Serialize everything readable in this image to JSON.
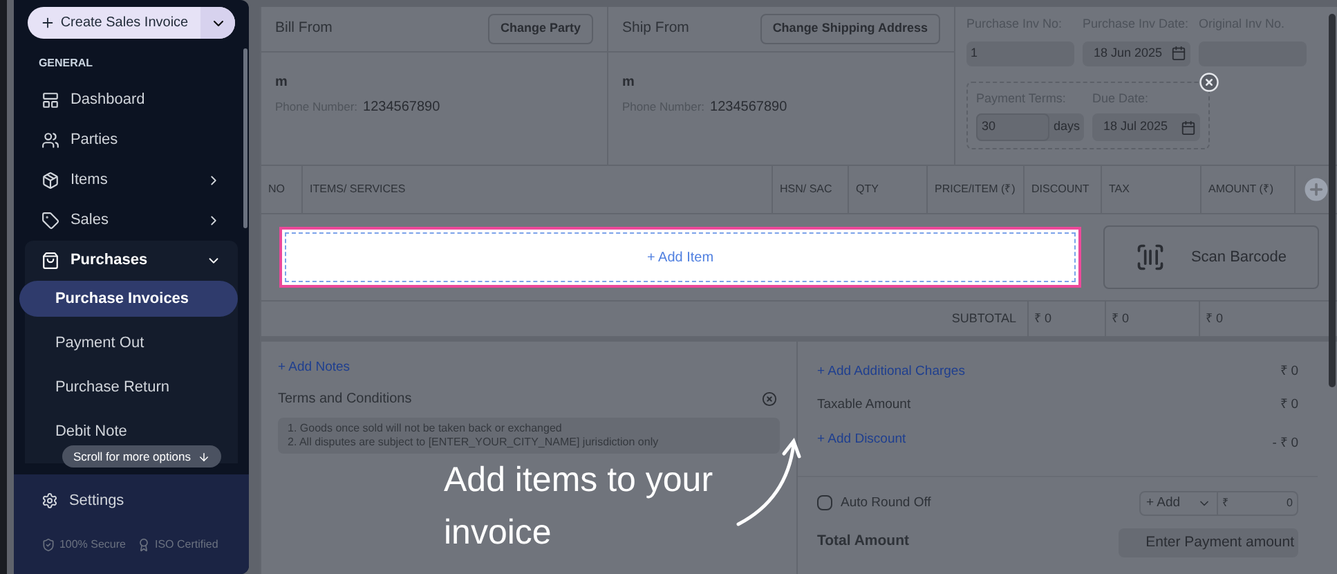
{
  "sidebar": {
    "create_button": {
      "label": "Create Sales Invoice"
    },
    "section": "GENERAL",
    "items": [
      {
        "label": "Dashboard",
        "expandable": false,
        "expanded": false
      },
      {
        "label": "Parties",
        "expandable": false,
        "expanded": false
      },
      {
        "label": "Items",
        "expandable": true,
        "expanded": false
      },
      {
        "label": "Sales",
        "expandable": true,
        "expanded": false
      },
      {
        "label": "Purchases",
        "expandable": true,
        "expanded": true,
        "children": [
          {
            "label": "Purchase Invoices",
            "selected": true
          },
          {
            "label": "Payment Out",
            "selected": false
          },
          {
            "label": "Purchase Return",
            "selected": false
          },
          {
            "label": "Debit Note",
            "selected": false
          }
        ]
      }
    ],
    "scroll_hint": "Scroll for more options",
    "settings": "Settings",
    "badges": [
      "100% Secure",
      "ISO Certified"
    ]
  },
  "bill_from": {
    "title": "Bill From",
    "button": "Change Party",
    "name": "m",
    "phone_label": "Phone Number:",
    "phone": "1234567890"
  },
  "ship_from": {
    "title": "Ship From",
    "button": "Change Shipping Address",
    "name": "m",
    "phone_label": "Phone Number:",
    "phone": "1234567890"
  },
  "invoice_info": {
    "inv_no_label": "Purchase Inv No:",
    "inv_no": "1",
    "inv_date_label": "Purchase Inv Date:",
    "inv_date": "18 Jun 2025",
    "original_label": "Original Inv No.",
    "terms_label": "Payment Terms:",
    "terms": "30",
    "terms_unit": "days",
    "due_label": "Due Date:",
    "due_date": "18 Jul 2025"
  },
  "table": {
    "columns": [
      "NO",
      "ITEMS/ SERVICES",
      "HSN/ SAC",
      "QTY",
      "PRICE/ITEM (₹)",
      "DISCOUNT",
      "TAX",
      "AMOUNT (₹)"
    ],
    "add_item": "+ Add Item",
    "scan_barcode": "Scan Barcode",
    "subtotal_label": "SUBTOTAL",
    "subtotals": [
      "₹ 0",
      "₹ 0",
      "₹ 0"
    ]
  },
  "notes": {
    "add_notes": "+ Add Notes",
    "terms_title": "Terms and Conditions",
    "terms_lines": [
      "1. Goods once sold will not be taken back or exchanged",
      "2. All disputes are subject to [ENTER_YOUR_CITY_NAME] jurisdiction only"
    ]
  },
  "totals": {
    "additional_charges": "+ Add Additional Charges",
    "additional_value": "₹ 0",
    "taxable_label": "Taxable Amount",
    "taxable_value": "₹ 0",
    "add_discount": "+ Add Discount",
    "discount_value": "- ₹ 0",
    "round_off_label": "Auto Round Off",
    "round_off_checked": false,
    "round_select": "+ Add",
    "round_currency": "₹",
    "round_value": "0",
    "total_label": "Total Amount",
    "payment_placeholder": "Enter Payment amount"
  },
  "tour": {
    "text": "Add items to your invoice"
  }
}
